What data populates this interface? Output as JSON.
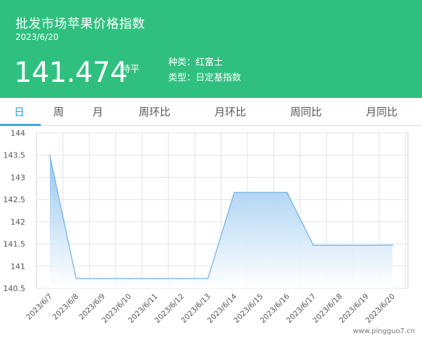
{
  "header": {
    "title": "批发市场苹果价格指数",
    "date": "2023/6/20",
    "price": "141.474",
    "trend": "持平",
    "variety": "种类：红富士",
    "index_type": "类型：日定基指数"
  },
  "tabs": [
    {
      "label": "日",
      "active": true
    },
    {
      "label": "周",
      "active": false
    },
    {
      "label": "月",
      "active": false
    },
    {
      "label": "周环比",
      "active": false
    },
    {
      "label": "月环比",
      "active": false
    },
    {
      "label": "周同比",
      "active": false
    },
    {
      "label": "月同比",
      "active": false
    }
  ],
  "chart_data": {
    "type": "area",
    "x": [
      "2023/6/7",
      "2023/6/8",
      "2023/6/9",
      "2023/6/10",
      "2023/6/11",
      "2023/6/12",
      "2023/6/13",
      "2023/6/14",
      "2023/6/15",
      "2023/6/16",
      "2023/6/17",
      "2023/6/18",
      "2023/6/19",
      "2023/6/20"
    ],
    "values": [
      143.5,
      140.72,
      140.72,
      140.72,
      140.72,
      140.72,
      140.72,
      142.66,
      142.66,
      142.66,
      141.47,
      141.47,
      141.47,
      141.474
    ],
    "ylim": [
      140.5,
      144
    ],
    "yticks": [
      "140.5",
      "141",
      "141.5",
      "142",
      "142.5",
      "143",
      "143.5",
      "144"
    ],
    "grid": true,
    "line_color": "#6aaee6",
    "fill_top": "#8ec3ef",
    "fill_bottom": "#ffffff"
  },
  "watermark": "www.pingguo7.cn"
}
